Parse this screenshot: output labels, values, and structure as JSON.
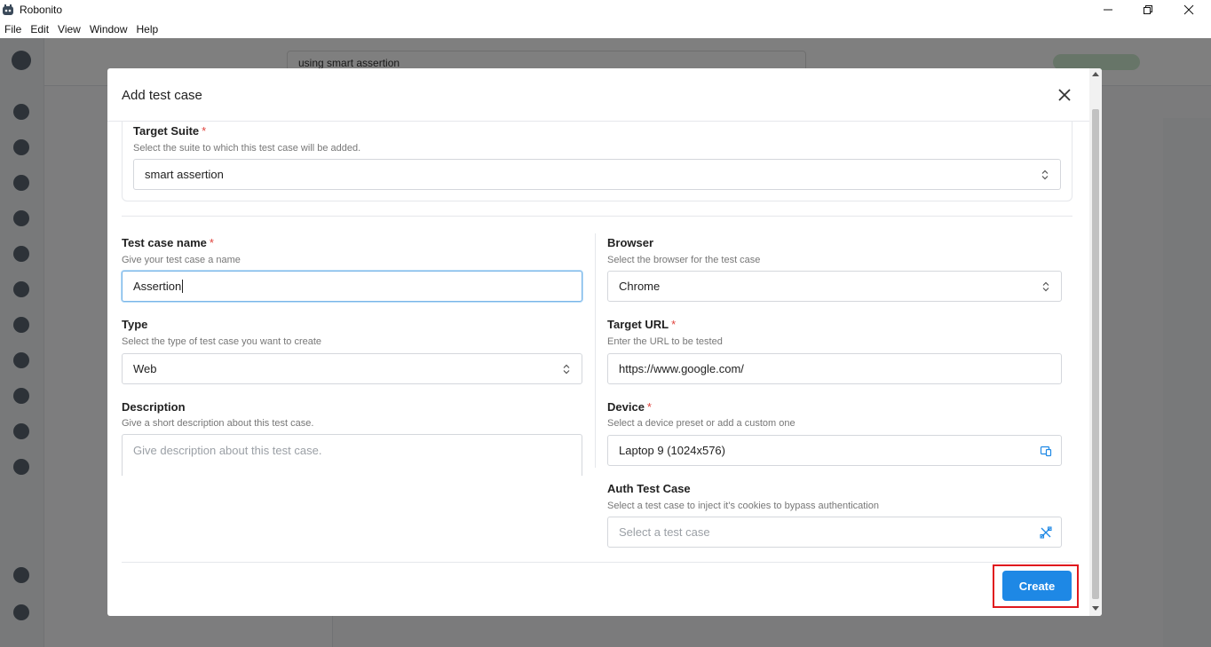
{
  "window": {
    "title": "Robonito",
    "menu": [
      "File",
      "Edit",
      "View",
      "Window",
      "Help"
    ]
  },
  "background": {
    "search_value": "using smart assertion"
  },
  "modal": {
    "title": "Add test case",
    "target_suite": {
      "label": "Target Suite",
      "hint": "Select the suite to which this test case will be added.",
      "value": "smart assertion"
    },
    "test_case_name": {
      "label": "Test case name",
      "hint": "Give your test case a name",
      "value": "Assertion"
    },
    "type": {
      "label": "Type",
      "hint": "Select the type of test case you want to create",
      "value": "Web"
    },
    "description": {
      "label": "Description",
      "hint": "Give a short description about this test case.",
      "placeholder": "Give description about this test case."
    },
    "browser": {
      "label": "Browser",
      "hint": "Select the browser for the test case",
      "value": "Chrome"
    },
    "target_url": {
      "label": "Target URL",
      "hint": "Enter the URL to be tested",
      "value": "https://www.google.com/"
    },
    "device": {
      "label": "Device",
      "hint": "Select a device preset or add a custom one",
      "value": "Laptop 9 (1024x576)"
    },
    "auth_test_case": {
      "label": "Auth Test Case",
      "hint": "Select a test case to inject it's cookies to bypass authentication",
      "placeholder": "Select a test case"
    },
    "required_marker": "*",
    "create_label": "Create"
  },
  "colors": {
    "primary": "#1e88e5",
    "required": "#e0443e",
    "highlight": "#e0191e"
  }
}
